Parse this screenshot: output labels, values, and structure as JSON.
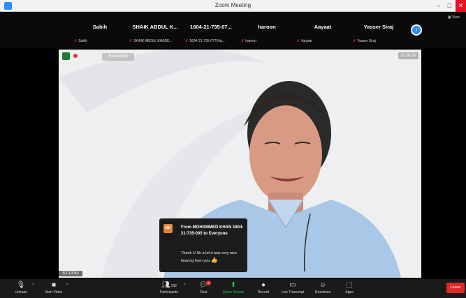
{
  "window": {
    "title": "Zoom Meeting",
    "minimize": "–",
    "maximize": "□",
    "close": "✕"
  },
  "gallery": {
    "tiles": [
      {
        "name": "Sabih",
        "sub": "Sabih"
      },
      {
        "name": "SHAIK ABDUL K...",
        "sub": "SHAIK ABDUL KHADE..."
      },
      {
        "name": "1604-21-735-07...",
        "sub": "1604-21-735-077(Ha..."
      },
      {
        "name": "haroon",
        "sub": "haroon"
      },
      {
        "name": "Aayaat",
        "sub": "Aayaat"
      },
      {
        "name": "Yasser Siraj",
        "sub": "Yasser Siraj"
      }
    ],
    "next_icon": "chevron-right-icon",
    "view_label": "View"
  },
  "video": {
    "recording_label": "Recording",
    "view_label": "01:00:28",
    "name_tag": "SJ 13:53",
    "speaker_description_colors": {
      "shirt": "#a9c7e6",
      "bg": "#eeeff1"
    }
  },
  "chat": {
    "avatar": "MK",
    "from": "From MOHAMMED KHAN 1604-21-735-005 to Everyone",
    "message": "Thank U Sir a lot it was very nice hearing from you",
    "emoji": "👍"
  },
  "toolbar": {
    "unmute": "Unmute",
    "start_video": "Start Video",
    "participants": "Participants",
    "participants_count": "102",
    "chat": "Chat",
    "chat_badge": "3",
    "share_screen": "Share Screen",
    "record": "Record",
    "live_transcript": "Live Transcript",
    "reactions": "Reactions",
    "apps": "Apps",
    "leave": "Leave"
  }
}
